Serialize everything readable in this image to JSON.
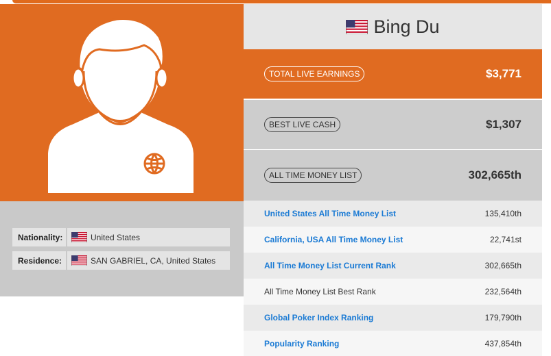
{
  "player": {
    "name": "Bing Du"
  },
  "details": {
    "nationality_label": "Nationality:",
    "nationality_value": "United States",
    "residence_label": "Residence:",
    "residence_value": "SAN GABRIEL, CA, United States"
  },
  "stats": {
    "total_live_earnings_label": "TOTAL LIVE EARNINGS",
    "total_live_earnings_value": "$3,771",
    "best_live_cash_label": "BEST LIVE CASH",
    "best_live_cash_value": "$1,307",
    "all_time_money_list_label": "ALL TIME MONEY LIST",
    "all_time_money_list_value": "302,665th"
  },
  "rankings": [
    {
      "label": "United States All Time Money List",
      "value": "135,410th",
      "link": true
    },
    {
      "label": "California, USA All Time Money List",
      "value": "22,741st",
      "link": true
    },
    {
      "label": "All Time Money List Current Rank",
      "value": "302,665th",
      "link": true
    },
    {
      "label": "All Time Money List Best Rank",
      "value": "232,564th",
      "link": false
    },
    {
      "label": "Global Poker Index Ranking",
      "value": "179,790th",
      "link": true
    },
    {
      "label": "Popularity Ranking",
      "value": "437,854th",
      "link": true
    }
  ],
  "icons": {
    "avatar": "person-silhouette-icon",
    "flag": "us-flag-icon"
  },
  "colors": {
    "accent": "#e06b21",
    "link": "#1a7ad4",
    "panel": "#cdcdcd"
  }
}
